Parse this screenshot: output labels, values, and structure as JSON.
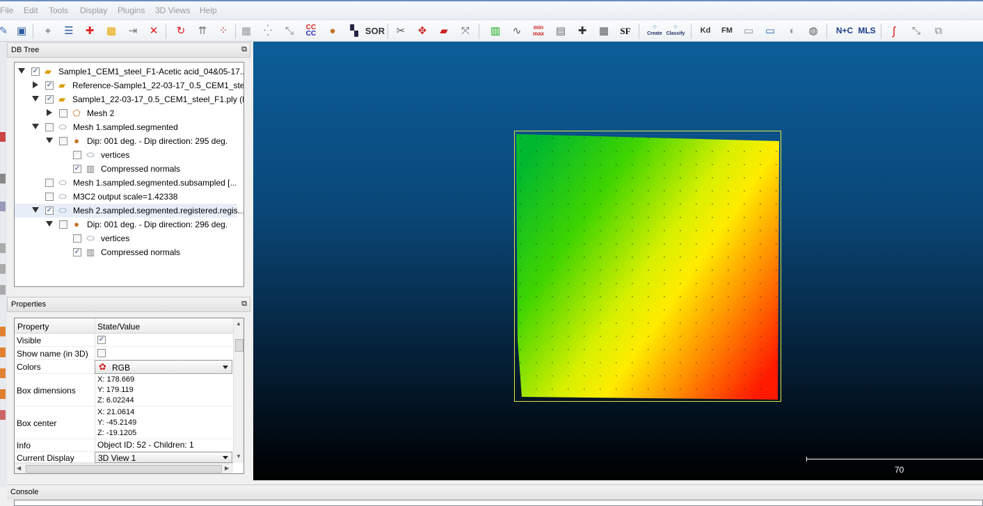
{
  "menu": [
    "File",
    "Edit",
    "Tools",
    "Display",
    "Plugins",
    "3D Views",
    "Help"
  ],
  "toolbar": {
    "sor_label": "SOR",
    "sf_label": "SF",
    "cc_label": "CC",
    "minmax_min": "min",
    "minmax_max": "max",
    "canupo_create": "Create",
    "canupo_classify": "Classify",
    "kd_label": "Kd",
    "fm_label": "FM",
    "nc_label": "N+C",
    "mls_label": "MLS"
  },
  "dbtree": {
    "title": "DB Tree",
    "items": [
      {
        "label": "Sample1_CEM1_steel_F1-Acetic acid_04&05-17....",
        "checked": true
      },
      {
        "label": "Reference-Sample1_22-03-17_0.5_CEM1_ste...",
        "checked": true
      },
      {
        "label": "Sample1_22-03-17_0.5_CEM1_steel_F1.ply (D...",
        "checked": true
      },
      {
        "label": "Mesh 2",
        "checked": false
      },
      {
        "label": "Mesh 1.sampled.segmented",
        "checked": false
      },
      {
        "label": "Dip: 001 deg. - Dip direction: 295 deg.",
        "checked": false
      },
      {
        "label": "vertices",
        "checked": false
      },
      {
        "label": "Compressed normals",
        "checked": true
      },
      {
        "label": "Mesh 1.sampled.segmented.subsampled [...",
        "checked": false
      },
      {
        "label": "M3C2 output scale=1.42338",
        "checked": false
      },
      {
        "label": "Mesh 2.sampled.segmented.registered.regis...",
        "checked": true
      },
      {
        "label": "Dip: 001 deg. - Dip direction: 296 deg.",
        "checked": false
      },
      {
        "label": "vertices",
        "checked": false
      },
      {
        "label": "Compressed normals",
        "checked": true
      }
    ]
  },
  "properties": {
    "title": "Properties",
    "col_property": "Property",
    "col_value": "State/Value",
    "visible_label": "Visible",
    "visible_checked": true,
    "show_name_label": "Show name (in 3D)",
    "show_name_checked": false,
    "colors_label": "Colors",
    "colors_value": "RGB",
    "box_dim_label": "Box dimensions",
    "box_dim": {
      "x": "X: 178.669",
      "y": "Y: 179.119",
      "z": "Z: 6.02244"
    },
    "box_center_label": "Box center",
    "box_center": {
      "x": "X: 21.0614",
      "y": "Y: -45.2149",
      "z": "Z: -19.1205"
    },
    "info_label": "Info",
    "info_value": "Object ID: 52 - Children: 1",
    "current_display_label": "Current Display",
    "current_display_value": "3D View 1"
  },
  "view": {
    "scale_value": "70"
  },
  "console": {
    "title": "Console"
  },
  "colors": {
    "view_top": "#0c5e9a",
    "view_bottom": "#000000",
    "bbox": "#e9e93a",
    "cloud_green": "#00c800",
    "cloud_yellow": "#ffff00",
    "cloud_red": "#ff1a00"
  }
}
